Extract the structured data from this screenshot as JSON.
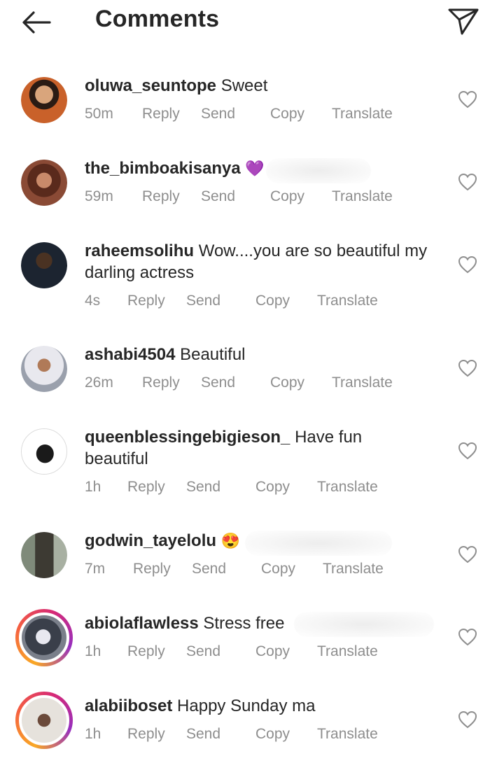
{
  "header": {
    "title": "Comments",
    "back_icon": "arrow-left-icon",
    "share_icon": "paper-plane-icon"
  },
  "actions": {
    "reply": "Reply",
    "send": "Send",
    "copy": "Copy",
    "translate": "Translate"
  },
  "colors": {
    "text": "#262626",
    "meta": "#8e8e8e",
    "story_ring": "#d62976"
  },
  "comments": [
    {
      "username": "oluwa_seuntope",
      "text": "Sweet",
      "time": "50m"
    },
    {
      "username": "the_bimboakisanya",
      "text": "💜",
      "time": "59m"
    },
    {
      "username": "raheemsolihu",
      "text": "Wow....you are so beautiful my darling actress",
      "time": "4s"
    },
    {
      "username": "ashabi4504",
      "text": "Beautiful",
      "time": "26m"
    },
    {
      "username": "queenblessingebigieson_",
      "text": "Have fun beautiful",
      "time": "1h"
    },
    {
      "username": "godwin_tayelolu",
      "text": "😍",
      "time": "7m"
    },
    {
      "username": "abiolaflawless",
      "text": "Stress free",
      "time": "1h"
    },
    {
      "username": "alabiiboset",
      "text": "Happy Sunday ma",
      "time": "1h"
    }
  ]
}
